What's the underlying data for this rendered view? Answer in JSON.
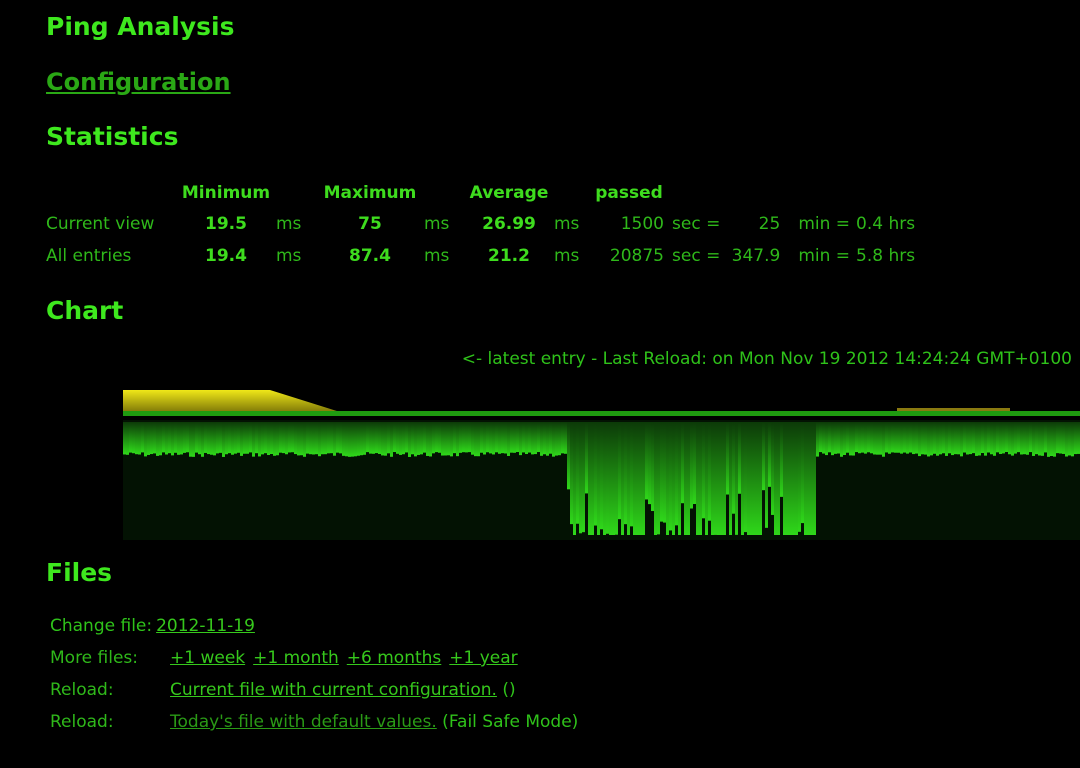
{
  "title": "Ping Analysis",
  "configuration_link": "Configuration",
  "statistics": {
    "heading": "Statistics",
    "headers": [
      "Minimum",
      "Maximum",
      "Average",
      "passed"
    ],
    "rows": [
      {
        "label": "Current view",
        "min": "19.5",
        "max": "75",
        "avg": "26.99",
        "unit": "ms",
        "sec": "1500",
        "sec_unit": "sec =",
        "min_val": "25",
        "min_unit": "min =",
        "hrs": "0.4 hrs"
      },
      {
        "label": "All entries",
        "min": "19.4",
        "max": "87.4",
        "avg": "21.2",
        "unit": "ms",
        "sec": "20875",
        "sec_unit": "sec =",
        "min_val": "347.9",
        "min_unit": "min =",
        "hrs": "5.8 hrs"
      }
    ]
  },
  "chart": {
    "heading": "Chart",
    "reload_text": "<- latest entry - Last Reload: on Mon Nov 19 2012 14:24:24 GMT+0100",
    "colors": {
      "bars": "#2fd81a",
      "line": "#1f9a10",
      "yellow": "#d8d010",
      "background": "#031203"
    }
  },
  "files": {
    "heading": "Files",
    "change_label": "Change file:",
    "change_value": "2012-11-19",
    "more_label": "More files:",
    "more_links": [
      "+1 week",
      "+1 month",
      "+6 months",
      "+1 year"
    ],
    "reload1_label": "Reload:",
    "reload1_link": "Current file with current configuration.",
    "reload1_suffix": " ()",
    "reload2_label": "Reload:",
    "reload2_link": "Today's file with default values.",
    "reload2_suffix": " (Fail Safe Mode)"
  }
}
